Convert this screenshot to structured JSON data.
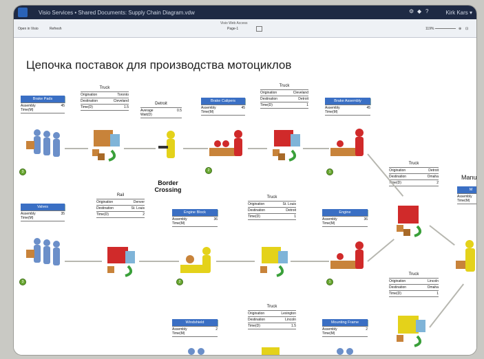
{
  "app": {
    "window_title": "Visio Services • Shared Documents: Supply Chain Diagram.vdw",
    "web_access_label": "Visio Web Access",
    "user": "Kirk Kars ▾",
    "toolbar": {
      "open": "Open in Visio",
      "refresh": "Refresh",
      "page": "Page-1",
      "zoom": "119%"
    }
  },
  "diagram": {
    "title": "Цепочка поставок для производства мотоциклов",
    "border_crossing": "Border\nCrossing",
    "manufacturing_partial": "Manu",
    "boxes": {
      "brake_pads": {
        "header": "Brake Pads",
        "label": "Assembly\nTime(M)",
        "value": "45"
      },
      "brake_calipers": {
        "header": "Brake Calipers",
        "label": "Assembly\nTime(M)",
        "value": "45"
      },
      "brake_assembly": {
        "header": "Brake Assembly",
        "label": "Assembly\nTime(M)",
        "value": "45"
      },
      "valves": {
        "header": "Valves",
        "label": "Assembly\nTime(M)",
        "value": "35"
      },
      "engine_block": {
        "header": "Engine Block",
        "label": "Assembly\nTime(M)",
        "value": "36"
      },
      "engine": {
        "header": "Engine",
        "label": "Assembly\nTime(M)",
        "value": "36"
      },
      "windshield": {
        "header": "Windshield",
        "label": "Assembly\nTime(M)",
        "value": "2"
      },
      "mounting_frame": {
        "header": "Mounting Frame",
        "label": "Assembly\nTime(M)",
        "value": "2"
      },
      "manu_partial": {
        "header": "M",
        "label": "Assembly\nTime(M)",
        "value": ""
      }
    },
    "detroit": {
      "caption": "Detroit",
      "label": "Average\nWait(D)",
      "value": "0.5"
    },
    "trucks": [
      {
        "caption": "Truck",
        "origination": "Toronto",
        "destination": "Cleveland",
        "time": "1.5"
      },
      {
        "caption": "Truck",
        "origination": "Cleveland",
        "destination": "Detroit",
        "time": "1"
      },
      {
        "caption": "Rail",
        "origination": "Denver",
        "destination": "St. Louis",
        "time": "2"
      },
      {
        "caption": "Truck",
        "origination": "St. Louis",
        "destination": "Detroit",
        "time": "1"
      },
      {
        "caption": "Truck",
        "origination": "Lexington",
        "destination": "Lincoln",
        "time": "1.5"
      },
      {
        "caption": "Truck",
        "origination": "Detroit",
        "destination": "Omaha",
        "time": "2"
      },
      {
        "caption": "Truck",
        "origination": "Lincoln",
        "destination": "Omaha",
        "time": "1"
      }
    ],
    "row_labels": {
      "origination": "Origination",
      "destination": "Destination",
      "time": "Time(D)"
    },
    "badges": [
      "3",
      "2",
      "1",
      "3",
      "2",
      "1"
    ],
    "colors": {
      "header_blue": "#3a6fc4",
      "red_actor": "#d02a2a",
      "yellow_actor": "#e4d21a",
      "blue_actor": "#6b8fc9",
      "crate": "#c8833a",
      "connector": "#b7b7b0"
    }
  }
}
